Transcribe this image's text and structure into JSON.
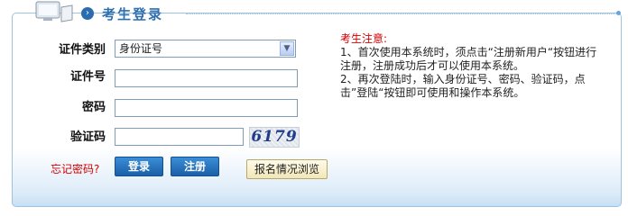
{
  "header": {
    "title": "考生登录"
  },
  "form": {
    "id_type_label": "证件类别",
    "id_type_value": "身份证号",
    "id_number_label": "证件号",
    "password_label": "密码",
    "captcha_label": "验证码",
    "captcha_text": "6179",
    "forgot_password": "忘记密码?",
    "login_button": "登录",
    "register_button": "注册",
    "browse_button": "报名情况浏览"
  },
  "notice": {
    "title": "考生注意:",
    "items": [
      "1、首次使用本系统时，须点击“注册新用户“按钮进行注册，注册成功后才可以使用本系统。",
      "2、再次登陆时，输入身份证号、密码、验证码，点击”登陆“按钮即可使用和操作本系统。"
    ]
  },
  "colors": {
    "accent": "#2f6fad",
    "warning": "#d20000"
  }
}
